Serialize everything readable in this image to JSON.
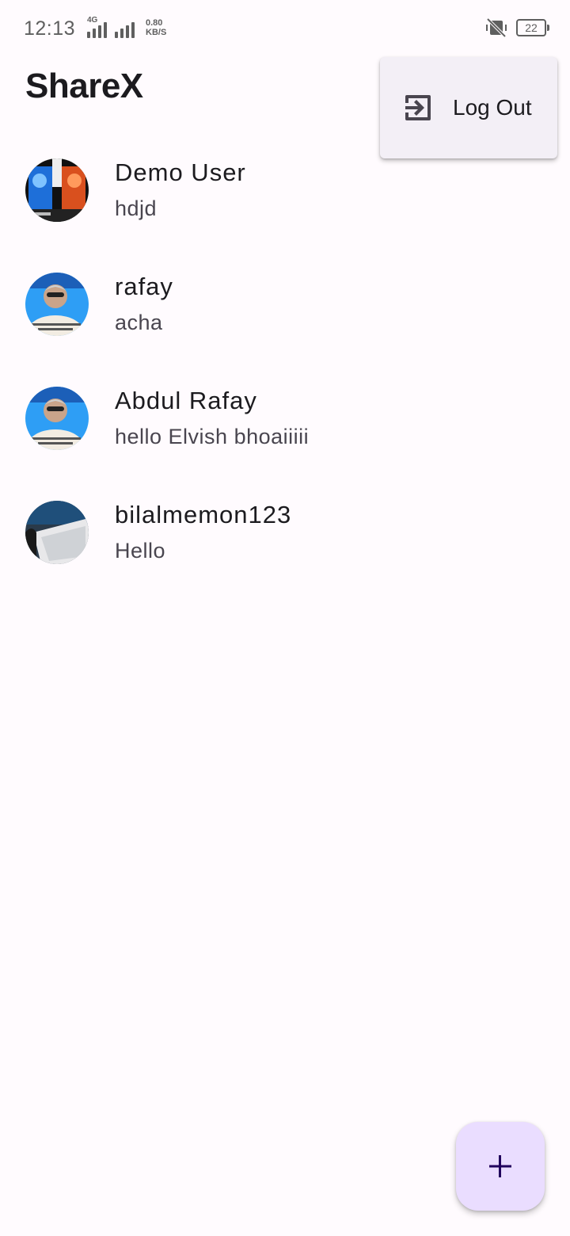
{
  "status_bar": {
    "time": "12:13",
    "network_type": "4G",
    "speed_value": "0.80",
    "speed_unit": "KB/S",
    "battery": "22",
    "icons": [
      "signal-icon",
      "signal-icon",
      "vibrate-off-icon",
      "battery-icon"
    ]
  },
  "app_bar": {
    "title": "ShareX"
  },
  "menu": {
    "items": [
      {
        "label": "Log Out",
        "icon": "logout-icon"
      }
    ]
  },
  "chats": [
    {
      "name": "Demo User",
      "last_message": "hdjd",
      "avatar": "avatar-comic"
    },
    {
      "name": "rafay",
      "last_message": "acha",
      "avatar": "avatar-person"
    },
    {
      "name": "Abdul Rafay",
      "last_message": "hello Elvish bhoaiiiii",
      "avatar": "avatar-person"
    },
    {
      "name": "bilalmemon123",
      "last_message": "Hello",
      "avatar": "avatar-keyboard"
    }
  ],
  "fab": {
    "icon": "plus-icon"
  },
  "colors": {
    "background": "#fffbfe",
    "fab": "#eaddff",
    "menu_surface": "#f3eff6",
    "text_primary": "#1c1b1f",
    "text_secondary": "#49454f"
  }
}
